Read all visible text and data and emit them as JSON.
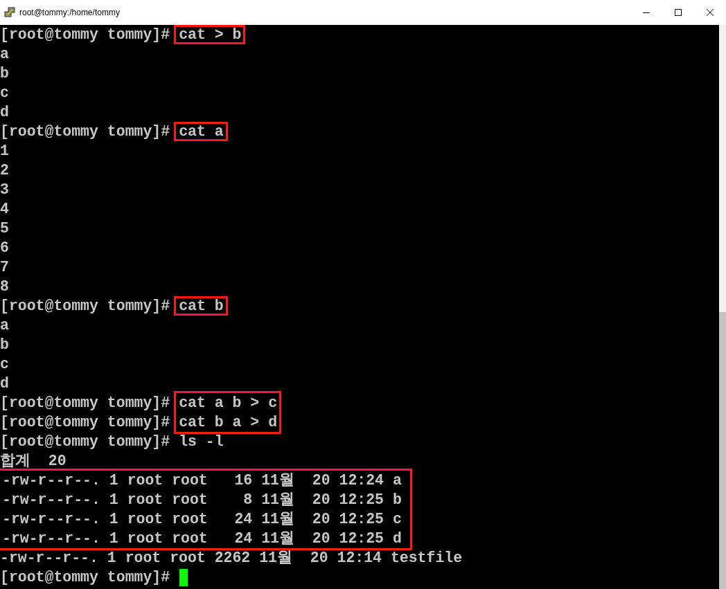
{
  "window": {
    "title": "root@tommy:/home/tommy"
  },
  "terminal": {
    "lines": [
      {
        "kind": "prompt",
        "prompt": "[root@tommy tommy]#",
        "command": "cat > b",
        "highlighted": true
      },
      {
        "kind": "output",
        "text": "a"
      },
      {
        "kind": "output",
        "text": "b"
      },
      {
        "kind": "output",
        "text": "c"
      },
      {
        "kind": "output",
        "text": "d"
      },
      {
        "kind": "prompt",
        "prompt": "[root@tommy tommy]#",
        "command": "cat a",
        "highlighted": true
      },
      {
        "kind": "output",
        "text": "1"
      },
      {
        "kind": "output",
        "text": "2"
      },
      {
        "kind": "output",
        "text": "3"
      },
      {
        "kind": "output",
        "text": "4"
      },
      {
        "kind": "output",
        "text": "5"
      },
      {
        "kind": "output",
        "text": "6"
      },
      {
        "kind": "output",
        "text": "7"
      },
      {
        "kind": "output",
        "text": "8"
      },
      {
        "kind": "prompt",
        "prompt": "[root@tommy tommy]#",
        "command": "cat b",
        "highlighted": true
      },
      {
        "kind": "output",
        "text": "a"
      },
      {
        "kind": "output",
        "text": "b"
      },
      {
        "kind": "output",
        "text": "c"
      },
      {
        "kind": "output",
        "text": "d"
      },
      {
        "kind": "prompt_group",
        "highlighted": true,
        "lines": [
          {
            "prompt": "[root@tommy tommy]#",
            "command": "cat a b > c"
          },
          {
            "prompt": "[root@tommy tommy]#",
            "command": "cat b a > d"
          }
        ]
      },
      {
        "kind": "prompt",
        "prompt": "[root@tommy tommy]#",
        "command": "ls -l",
        "highlighted": false
      },
      {
        "kind": "output",
        "text": "합계  20"
      },
      {
        "kind": "output_group",
        "highlighted": true,
        "lines": [
          "-rw-r--r--. 1 root root   16 11월  20 12:24 a",
          "-rw-r--r--. 1 root root    8 11월  20 12:25 b",
          "-rw-r--r--. 1 root root   24 11월  20 12:25 c",
          "-rw-r--r--. 1 root root   24 11월  20 12:25 d"
        ]
      },
      {
        "kind": "output",
        "text": "-rw-r--r--. 1 root root 2262 11월  20 12:14 testfile"
      },
      {
        "kind": "cursor_prompt",
        "prompt": "[root@tommy tommy]#"
      }
    ]
  }
}
